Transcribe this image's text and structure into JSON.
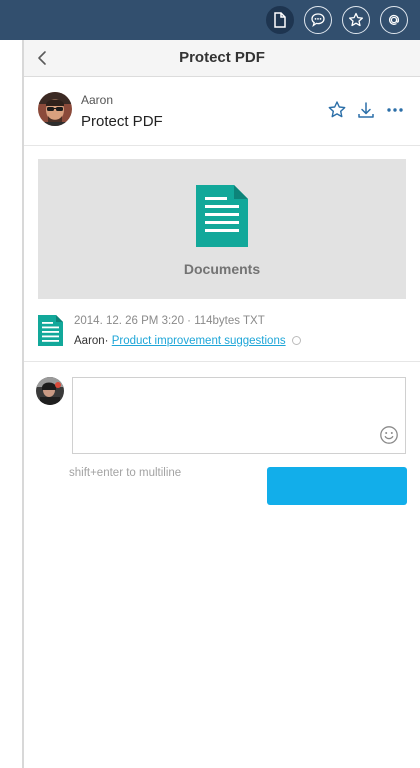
{
  "toolbar": {
    "icons": [
      "document-icon",
      "comment-icon",
      "star-icon",
      "at-icon"
    ]
  },
  "panel": {
    "title": "Protect PDF"
  },
  "post": {
    "author": "Aaron",
    "title": "Protect PDF"
  },
  "preview": {
    "label": "Documents"
  },
  "file": {
    "meta": "2014. 12. 26 PM 3:20 · 114bytes TXT",
    "owner": "Aaron·",
    "link": "Product improvement suggestions"
  },
  "comment": {
    "placeholder": "",
    "hint": "shift+enter to multiline",
    "submit_label": ""
  },
  "colors": {
    "topbar": "#324f6e",
    "accent": "#12aeea",
    "doc_green": "#12a89a",
    "icon_blue": "#2c6fa8"
  }
}
